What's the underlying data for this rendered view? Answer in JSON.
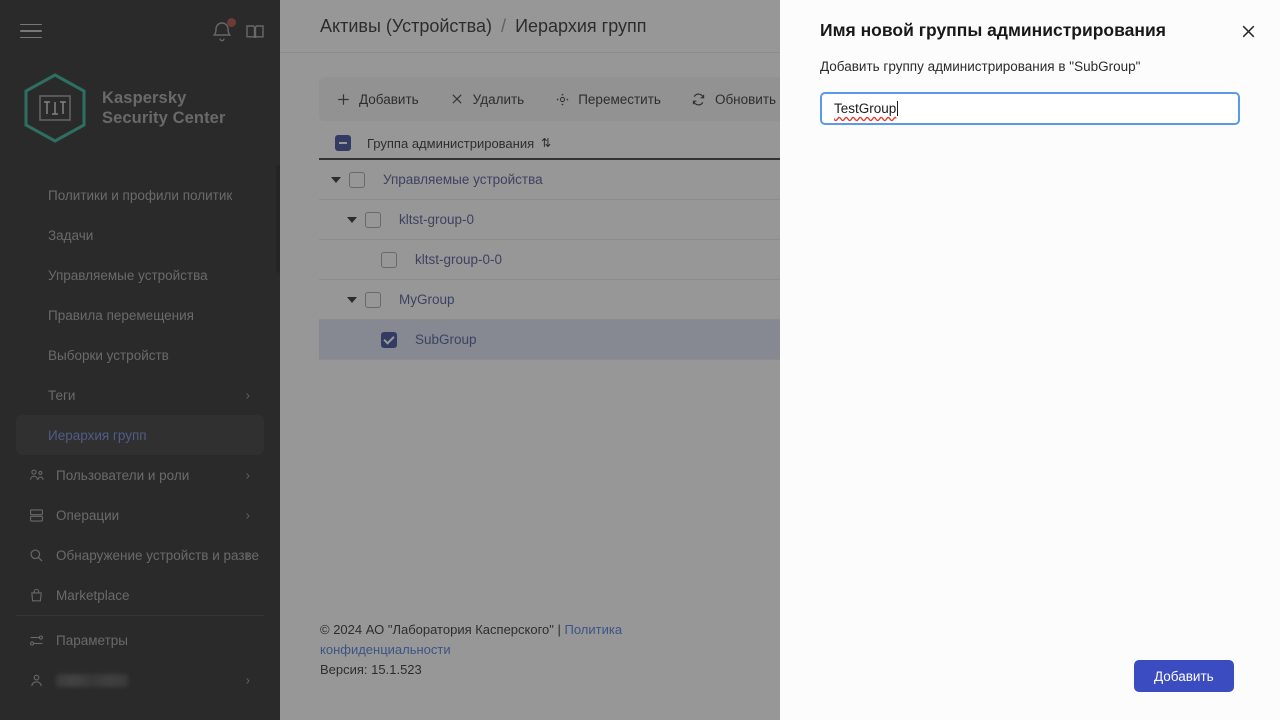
{
  "app": {
    "brand_line1": "Kaspersky",
    "brand_line2": "Security Center"
  },
  "topbar": {
    "menu_icon": "hamburger-icon",
    "notifications_icon": "bell-icon",
    "help_icon": "book-icon"
  },
  "sidebar": {
    "items": [
      {
        "label": "Политики и профили политик",
        "icon": null,
        "chevron": false,
        "active": false
      },
      {
        "label": "Задачи",
        "icon": null,
        "chevron": false,
        "active": false
      },
      {
        "label": "Управляемые устройства",
        "icon": null,
        "chevron": false,
        "active": false
      },
      {
        "label": "Правила перемещения",
        "icon": null,
        "chevron": false,
        "active": false
      },
      {
        "label": "Выборки устройств",
        "icon": null,
        "chevron": false,
        "active": false
      },
      {
        "label": "Теги",
        "icon": null,
        "chevron": true,
        "active": false
      },
      {
        "label": "Иерархия групп",
        "icon": null,
        "chevron": false,
        "active": true
      },
      {
        "label": "Пользователи и роли",
        "icon": "users-icon",
        "chevron": true,
        "active": false
      },
      {
        "label": "Операции",
        "icon": "stack-icon",
        "chevron": true,
        "active": false
      },
      {
        "label": "Обнаружение устройств и разве",
        "icon": "search-icon",
        "chevron": true,
        "active": false
      },
      {
        "label": "Marketplace",
        "icon": "bag-icon",
        "chevron": false,
        "active": false
      }
    ],
    "bottom_items": [
      {
        "label": "Параметры",
        "icon": "sliders-icon",
        "chevron": false,
        "redacted": false
      },
      {
        "label": "",
        "icon": "user-icon",
        "chevron": true,
        "redacted": true
      }
    ],
    "chevron_glyph": "›"
  },
  "breadcrumb": {
    "parent": "Активы (Устройства)",
    "separator": "/",
    "current": "Иерархия групп"
  },
  "toolbar": {
    "buttons": [
      {
        "label": "Добавить",
        "icon": "plus-icon"
      },
      {
        "label": "Удалить",
        "icon": "close-x-icon"
      },
      {
        "label": "Переместить",
        "icon": "move-icon"
      },
      {
        "label": "Обновить",
        "icon": "refresh-icon"
      }
    ]
  },
  "table": {
    "header_checkbox_state": "indeterminate",
    "column_label": "Группа администрирования",
    "sort_glyph": "⇅",
    "rows": [
      {
        "label": "Управляемые устройства",
        "depth": 0,
        "expanded": true,
        "has_children": true,
        "checked": false,
        "selected": false
      },
      {
        "label": "kltst-group-0",
        "depth": 1,
        "expanded": true,
        "has_children": true,
        "checked": false,
        "selected": false
      },
      {
        "label": "kltst-group-0-0",
        "depth": 2,
        "expanded": false,
        "has_children": false,
        "checked": false,
        "selected": false
      },
      {
        "label": "MyGroup",
        "depth": 1,
        "expanded": true,
        "has_children": true,
        "checked": false,
        "selected": false
      },
      {
        "label": "SubGroup",
        "depth": 2,
        "expanded": false,
        "has_children": false,
        "checked": true,
        "selected": true
      }
    ]
  },
  "footer": {
    "copyright": "© 2024 АО \"Лаборатория Касперского\" | ",
    "privacy_link": "Политика конфиденциальности",
    "version": "Версия: 15.1.523"
  },
  "dialog": {
    "title": "Имя новой группы администрирования",
    "subtitle": "Добавить группу администрирования в \"SubGroup\"",
    "input_value": "TestGroup",
    "input_placeholder": "",
    "submit_label": "Добавить",
    "close_icon": "close-x-icon"
  },
  "colors": {
    "brand_green": "#1fa98a",
    "accent_blue": "#3b4bc0",
    "link_blue": "#3d6fd7",
    "sidebar_bg": "#171717",
    "focus_border": "#5a9ae8",
    "notification_red": "#a13b38",
    "spellcheck_red": "#e03b2f"
  }
}
